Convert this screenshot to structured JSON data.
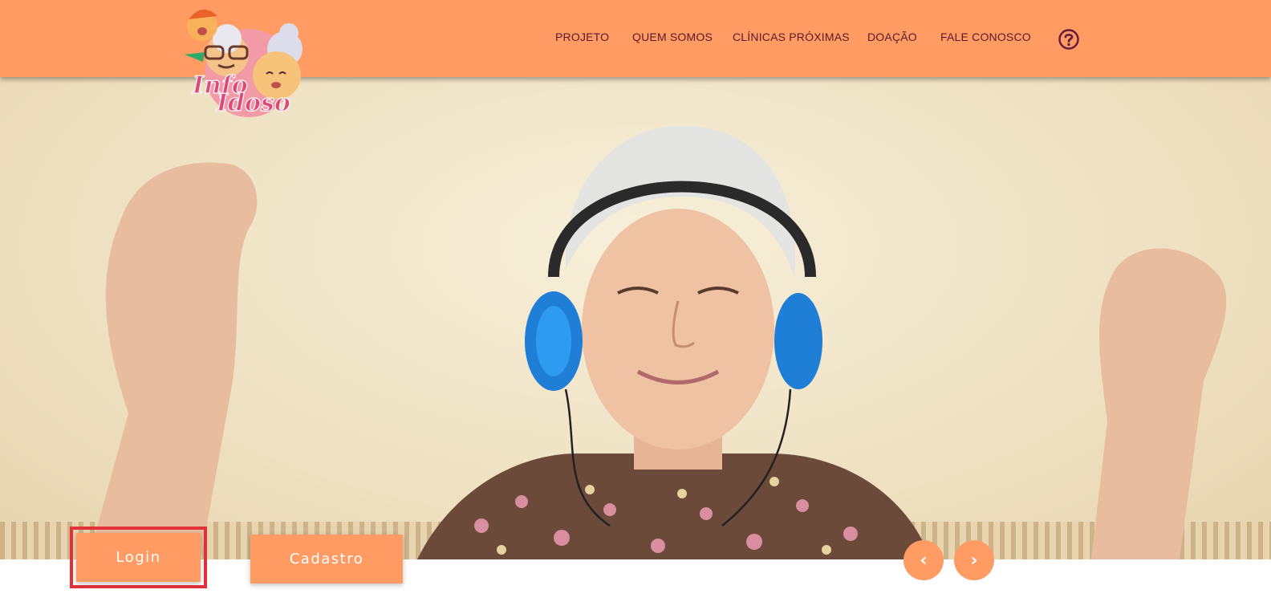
{
  "header": {
    "nav": [
      {
        "label": "PROJETO"
      },
      {
        "label": "QUEM SOMOS"
      },
      {
        "label": "CLÍNICAS PRÓXIMAS"
      },
      {
        "label": "DOAÇÃO"
      },
      {
        "label": "FALE CONOSCO"
      }
    ],
    "help_icon": "question-circle-icon",
    "logo_text_line1": "Info",
    "logo_text_line2": "Idoso"
  },
  "hero": {
    "image": "elderly-woman-with-headphones-photo"
  },
  "actions": {
    "login_label": "Login",
    "signup_label": "Cadastro"
  },
  "carousel": {
    "prev_icon": "chevron-left-icon",
    "next_icon": "chevron-right-icon",
    "prev_glyph": "‹",
    "next_glyph": "›"
  },
  "colors": {
    "brand_orange": "#ff9b63",
    "nav_text": "#5a1a2a",
    "highlight_red": "#e2313b"
  }
}
